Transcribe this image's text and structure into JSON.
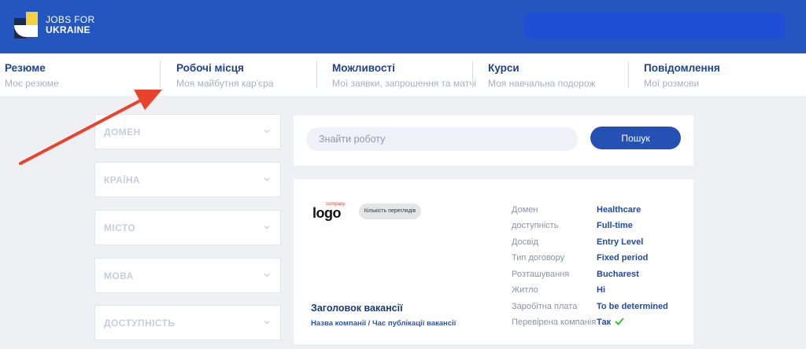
{
  "brand": {
    "line1": "JOBS FOR",
    "line2": "UKRAINE",
    "colors": {
      "header": "#2456bf",
      "yellow": "#f5cf3c",
      "dark": "#1a2b4c"
    }
  },
  "nav": [
    {
      "title": "Резюме",
      "subtitle": "Моє резюме"
    },
    {
      "title": "Робочі місця",
      "subtitle": "Моя майбутня кар'єра"
    },
    {
      "title": "Можливості",
      "subtitle": "Мої заявки, запрошення та матчі"
    },
    {
      "title": "Курси",
      "subtitle": "Моя навчальна подорож"
    },
    {
      "title": "Повідомлення",
      "subtitle": "Мої розмови"
    }
  ],
  "filters": [
    "ДОМЕН",
    "КРАЇНА",
    "МІСТО",
    "МОВА",
    "ДОСТУПНІСТЬ"
  ],
  "search": {
    "placeholder": "Знайти роботу",
    "button": "Пошук"
  },
  "job": {
    "logo_small": "company",
    "logo_big": "logo",
    "views_label": "Кількість переглядів",
    "title": "Заголовок вакансії",
    "company_line": "Назва компанії / Час публікації вакансії",
    "details": [
      {
        "key": "Домен",
        "value": "Healthcare"
      },
      {
        "key": "доступність",
        "value": "Full-time"
      },
      {
        "key": "Досвід",
        "value": "Entry Level"
      },
      {
        "key": "Тип договору",
        "value": "Fixed period"
      },
      {
        "key": "Розташування",
        "value": "Bucharest"
      },
      {
        "key": "Житло",
        "value": "Hi"
      },
      {
        "key": "Заробітна плата",
        "value": "To be determined"
      },
      {
        "key": "Перевірена компанія",
        "value": "Так"
      }
    ]
  },
  "icons": {
    "arrow": "red-pointer-arrow",
    "chevron": "chevron-down-icon",
    "check": "check-icon",
    "arrow_color": "#e8432d",
    "check_color": "#3cba4a"
  }
}
